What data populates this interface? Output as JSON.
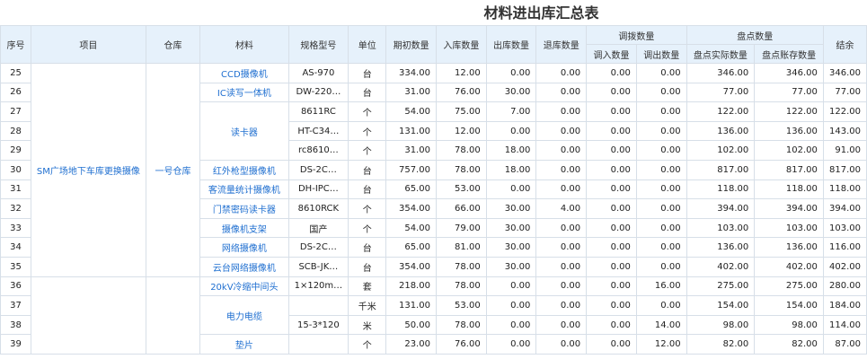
{
  "title": "材料进出库汇总表",
  "headers": {
    "seq": "序号",
    "project": "项目",
    "warehouse": "仓库",
    "material": "材料",
    "spec": "规格型号",
    "unit": "单位",
    "opening": "期初数量",
    "in": "入库数量",
    "out": "出库数量",
    "return": "退库数量",
    "transfer": "调拨数量",
    "transfer_in": "调入数量",
    "transfer_out": "调出数量",
    "stocktake": "盘点数量",
    "stock_actual": "盘点实际数量",
    "stock_book": "盘点账存数量",
    "balance": "结余"
  },
  "groups": {
    "project_a": "SM广场地下车库更换摄像",
    "warehouse_a": "一号仓库"
  },
  "rows": [
    {
      "seq": "25",
      "material": "CCD摄像机",
      "spec": "AS-970",
      "unit": "台",
      "opening": "334.00",
      "in": "12.00",
      "out": "0.00",
      "return": "0.00",
      "tin": "0.00",
      "tout": "0.00",
      "actual": "346.00",
      "book": "346.00",
      "bal": "346.00"
    },
    {
      "seq": "26",
      "material": "IC读写一体机",
      "spec": "DW-220…",
      "unit": "台",
      "opening": "31.00",
      "in": "76.00",
      "out": "30.00",
      "return": "0.00",
      "tin": "0.00",
      "tout": "0.00",
      "actual": "77.00",
      "book": "77.00",
      "bal": "77.00"
    },
    {
      "seq": "27",
      "material": "读卡器",
      "spec": "8611RC",
      "unit": "个",
      "opening": "54.00",
      "in": "75.00",
      "out": "7.00",
      "return": "0.00",
      "tin": "0.00",
      "tout": "0.00",
      "actual": "122.00",
      "book": "122.00",
      "bal": "122.00"
    },
    {
      "seq": "28",
      "material": "",
      "spec": "HT-C34…",
      "unit": "个",
      "opening": "131.00",
      "in": "12.00",
      "out": "0.00",
      "return": "0.00",
      "tin": "0.00",
      "tout": "0.00",
      "actual": "136.00",
      "book": "136.00",
      "bal": "143.00"
    },
    {
      "seq": "29",
      "material": "",
      "spec": "rc8610…",
      "unit": "个",
      "opening": "31.00",
      "in": "78.00",
      "out": "18.00",
      "return": "0.00",
      "tin": "0.00",
      "tout": "0.00",
      "actual": "102.00",
      "book": "102.00",
      "bal": "91.00"
    },
    {
      "seq": "30",
      "material": "红外枪型摄像机",
      "spec": "DS-2C…",
      "unit": "台",
      "opening": "757.00",
      "in": "78.00",
      "out": "18.00",
      "return": "0.00",
      "tin": "0.00",
      "tout": "0.00",
      "actual": "817.00",
      "book": "817.00",
      "bal": "817.00"
    },
    {
      "seq": "31",
      "material": "客流量统计摄像机",
      "spec": "DH-IPC…",
      "unit": "台",
      "opening": "65.00",
      "in": "53.00",
      "out": "0.00",
      "return": "0.00",
      "tin": "0.00",
      "tout": "0.00",
      "actual": "118.00",
      "book": "118.00",
      "bal": "118.00"
    },
    {
      "seq": "32",
      "material": "门禁密码读卡器",
      "spec": "8610RCK",
      "unit": "个",
      "opening": "354.00",
      "in": "66.00",
      "out": "30.00",
      "return": "4.00",
      "tin": "0.00",
      "tout": "0.00",
      "actual": "394.00",
      "book": "394.00",
      "bal": "394.00"
    },
    {
      "seq": "33",
      "material": "摄像机支架",
      "spec": "国产",
      "unit": "个",
      "opening": "54.00",
      "in": "79.00",
      "out": "30.00",
      "return": "0.00",
      "tin": "0.00",
      "tout": "0.00",
      "actual": "103.00",
      "book": "103.00",
      "bal": "103.00"
    },
    {
      "seq": "34",
      "material": "网络摄像机",
      "spec": "DS-2C…",
      "unit": "台",
      "opening": "65.00",
      "in": "81.00",
      "out": "30.00",
      "return": "0.00",
      "tin": "0.00",
      "tout": "0.00",
      "actual": "136.00",
      "book": "136.00",
      "bal": "116.00"
    },
    {
      "seq": "35",
      "material": "云台网络摄像机",
      "spec": "SCB-JK…",
      "unit": "台",
      "opening": "354.00",
      "in": "78.00",
      "out": "30.00",
      "return": "0.00",
      "tin": "0.00",
      "tout": "0.00",
      "actual": "402.00",
      "book": "402.00",
      "bal": "402.00"
    },
    {
      "seq": "36",
      "material": "20kV冷缩中间头",
      "spec": "1×120m…",
      "unit": "套",
      "opening": "218.00",
      "in": "78.00",
      "out": "0.00",
      "return": "0.00",
      "tin": "0.00",
      "tout": "16.00",
      "actual": "275.00",
      "book": "275.00",
      "bal": "280.00"
    },
    {
      "seq": "37",
      "material": "电力电缆",
      "spec": "",
      "unit": "千米",
      "opening": "131.00",
      "in": "53.00",
      "out": "0.00",
      "return": "0.00",
      "tin": "0.00",
      "tout": "0.00",
      "actual": "154.00",
      "book": "154.00",
      "bal": "184.00"
    },
    {
      "seq": "38",
      "material": "",
      "spec": "15-3*120",
      "unit": "米",
      "opening": "50.00",
      "in": "78.00",
      "out": "0.00",
      "return": "0.00",
      "tin": "0.00",
      "tout": "14.00",
      "actual": "98.00",
      "book": "98.00",
      "bal": "114.00"
    },
    {
      "seq": "39",
      "material": "垫片",
      "spec": "",
      "unit": "个",
      "opening": "23.00",
      "in": "76.00",
      "out": "0.00",
      "return": "0.00",
      "tin": "0.00",
      "tout": "12.00",
      "actual": "82.00",
      "book": "82.00",
      "bal": "87.00"
    }
  ]
}
